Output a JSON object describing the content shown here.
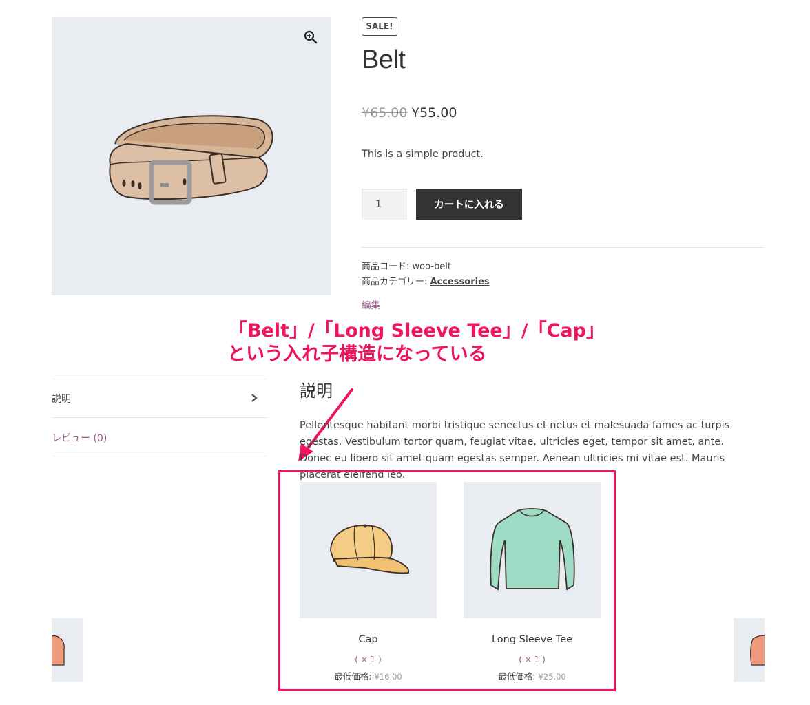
{
  "product": {
    "badge": "SALE!",
    "title": "Belt",
    "price_regular": "¥65.00",
    "price_sale": "¥55.00",
    "short_description": "This is a simple product.",
    "quantity": "1",
    "add_to_cart_label": "カートに入れる",
    "sku_label": "商品コード: ",
    "sku_value": "woo-belt",
    "category_label": "商品カテゴリー: ",
    "category_value": "Accessories",
    "edit_label": "編集"
  },
  "annotation": {
    "line1": "「Belt」/「Long Sleeve Tee」/「Cap」",
    "line2": "という入れ子構造になっている",
    "color": "#f0145a"
  },
  "tabs": [
    {
      "label": "説明"
    },
    {
      "label": "レビュー (0)"
    }
  ],
  "description": {
    "heading": "説明",
    "text": "Pellentesque habitant morbi tristique senectus et netus et malesuada fames ac turpis egestas. Vestibulum tortor quam, feugiat vitae, ultricies eget, tempor sit amet, ante. Donec eu libero sit amet quam egestas semper. Aenean ultricies mi vitae est. Mauris placerat eleifend leo."
  },
  "nested_products": [
    {
      "name": "Cap",
      "qty": "( × 1 )",
      "min_label": "最低価格: ",
      "min_price": "¥16.00",
      "icon": "cap-image"
    },
    {
      "name": "Long Sleeve Tee",
      "qty": "( × 1 )",
      "min_label": "最低価格: ",
      "min_price": "¥25.00",
      "icon": "long-sleeve-tee-image"
    }
  ],
  "colors": {
    "accent_purple": "#96588a",
    "button_dark": "#333333",
    "image_bg": "#e9edf2",
    "highlight": "#ee1558"
  }
}
